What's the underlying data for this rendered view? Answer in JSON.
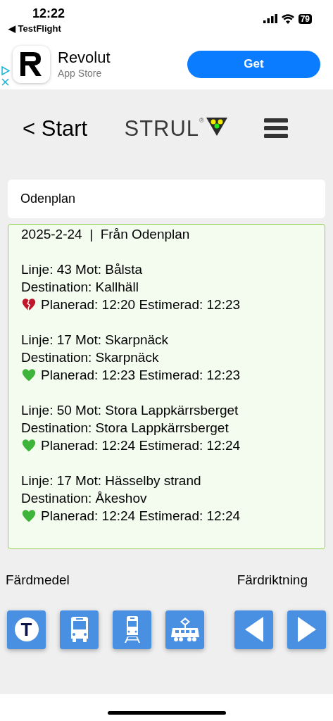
{
  "status_bar": {
    "time": "12:22",
    "back_app": "◀ TestFlight",
    "battery": "79"
  },
  "ad": {
    "app_name": "Revolut",
    "store": "App Store",
    "button": "Get"
  },
  "header": {
    "back": "< Start",
    "logo": "STRUL",
    "logo_mark": "®"
  },
  "search": {
    "value": "Odenplan"
  },
  "departures": {
    "heading": "2025-2-24  |  Från Odenplan",
    "items": [
      {
        "line": "Linje: 43 Mot: Bålsta",
        "destination": "Destination: Kallhäll",
        "times": "Planerad: 12:20 Estimerad: 12:23",
        "late": true
      },
      {
        "line": "Linje: 17 Mot: Skarpnäck",
        "destination": "Destination: Skarpnäck",
        "times": "Planerad: 12:23 Estimerad: 12:23",
        "late": false
      },
      {
        "line": "Linje: 50 Mot: Stora Lappkärrsberget",
        "destination": "Destination: Stora Lappkärrsberget",
        "times": "Planerad: 12:24 Estimerad: 12:24",
        "late": false
      },
      {
        "line": "Linje: 17 Mot: Hässelby strand",
        "destination": "Destination: Åkeshov",
        "times": "Planerad: 12:24 Estimerad: 12:24",
        "late": false
      }
    ]
  },
  "modes_label": "Färdmedel",
  "direction_label": "Färdriktning",
  "modes": [
    {
      "kind": "metro",
      "text": "T"
    },
    {
      "kind": "bus"
    },
    {
      "kind": "train"
    },
    {
      "kind": "tram"
    }
  ],
  "directions": [
    {
      "kind": "left"
    },
    {
      "kind": "right"
    }
  ]
}
